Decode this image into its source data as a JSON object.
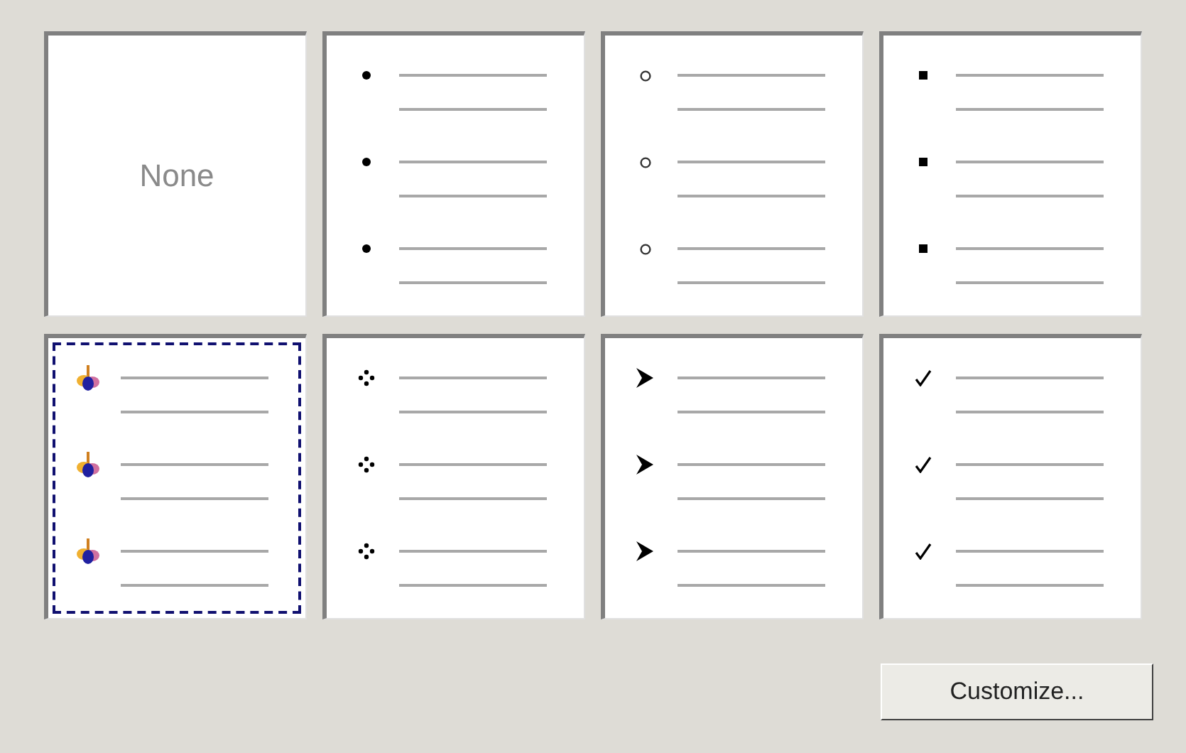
{
  "bullets": [
    {
      "kind": "none",
      "label": "None",
      "selected": false
    },
    {
      "kind": "disc",
      "selected": false
    },
    {
      "kind": "circle",
      "selected": false
    },
    {
      "kind": "square",
      "selected": false
    },
    {
      "kind": "picture",
      "selected": true
    },
    {
      "kind": "dots",
      "selected": false
    },
    {
      "kind": "arrow",
      "selected": false
    },
    {
      "kind": "check",
      "selected": false
    }
  ],
  "customize_button": {
    "label": "Customize..."
  }
}
